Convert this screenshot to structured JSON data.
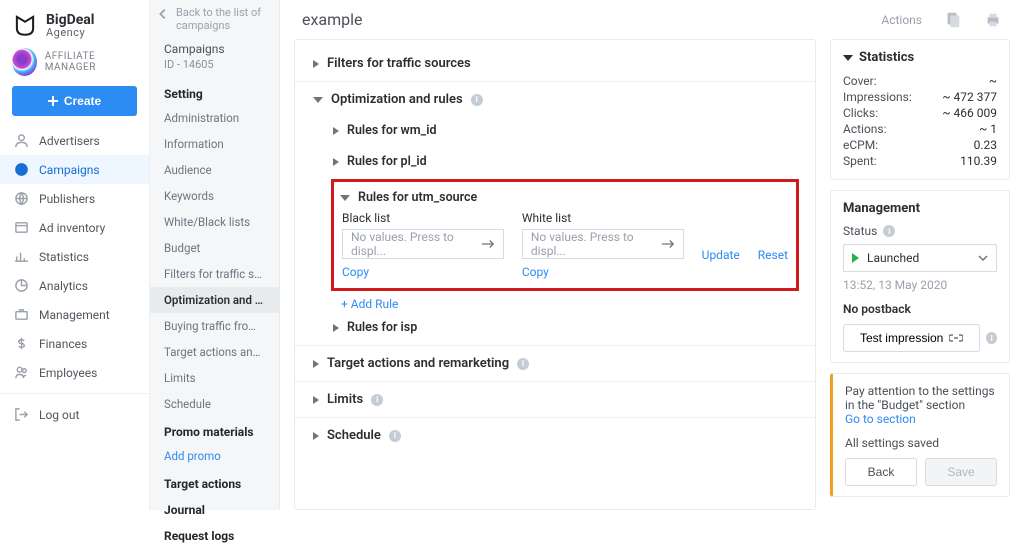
{
  "brand": {
    "name": "BigDeal",
    "sub": "Agency"
  },
  "user": {
    "role": "AFFILIATE MANAGER"
  },
  "create_label": "Create",
  "nav": [
    {
      "label": "Advertisers"
    },
    {
      "label": "Campaigns"
    },
    {
      "label": "Publishers"
    },
    {
      "label": "Ad inventory"
    },
    {
      "label": "Statistics"
    },
    {
      "label": "Analytics"
    },
    {
      "label": "Management"
    },
    {
      "label": "Finances"
    },
    {
      "label": "Employees"
    }
  ],
  "logout_label": "Log out",
  "subnav": {
    "back": "Back to the list of campaigns",
    "header": "Campaigns",
    "id": "ID - 14605",
    "section": "Setting",
    "items": [
      "Administration",
      "Information",
      "Audience",
      "Keywords",
      "White/Black lists",
      "Budget",
      "Filters for traffic sou...",
      "Optimization and rules",
      "Buying traffic from S...",
      "Target actions and re...",
      "Limits",
      "Schedule"
    ],
    "promo_section": "Promo materials",
    "add_promo": "Add promo",
    "target_actions": "Target actions",
    "journal": "Journal",
    "request_logs": "Request logs"
  },
  "page": {
    "title": "example",
    "actions": "Actions"
  },
  "acc": {
    "filters": "Filters for traffic sources",
    "opt": "Optimization and rules",
    "rules_wm": "Rules for wm_id",
    "rules_pl": "Rules for pl_id",
    "rules_utm": "Rules for utm_source",
    "black_label": "Black list",
    "white_label": "White list",
    "placeholder": "No values. Press to displ...",
    "copy": "Copy",
    "update": "Update",
    "reset": "Reset",
    "add_rule": "+ Add Rule",
    "rules_isp": "Rules for isp",
    "target": "Target actions and remarketing",
    "limits": "Limits",
    "schedule": "Schedule"
  },
  "stats": {
    "title": "Statistics",
    "rows": [
      {
        "k": "Cover:",
        "v": "~"
      },
      {
        "k": "Impressions:",
        "v": "~ 472 377"
      },
      {
        "k": "Clicks:",
        "v": "~ 466 009"
      },
      {
        "k": "Actions:",
        "v": "~ 1"
      },
      {
        "k": "eCPM:",
        "v": "0.23"
      },
      {
        "k": "Spent:",
        "v": "110.39"
      }
    ]
  },
  "mgmt": {
    "title": "Management",
    "status_label": "Status",
    "status_value": "Launched",
    "timestamp": "13:52, 13 May 2020",
    "no_postback": "No postback",
    "test_label": "Test impression"
  },
  "warn": {
    "text": "Pay attention to the settings in the \"Budget\" section",
    "link": "Go to section",
    "saved": "All settings saved",
    "back": "Back",
    "save": "Save"
  }
}
